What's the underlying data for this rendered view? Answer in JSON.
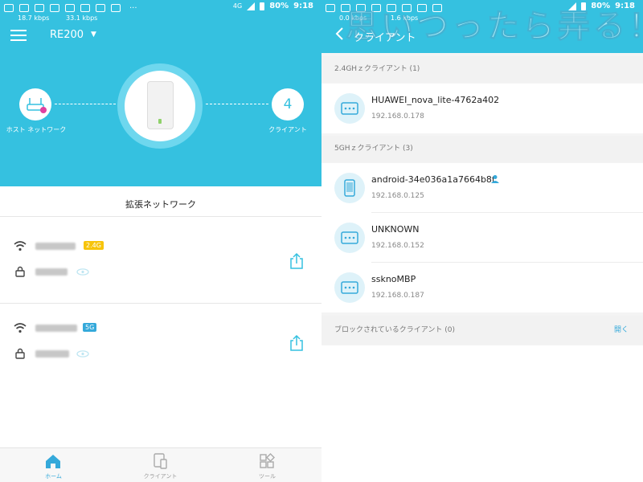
{
  "left": {
    "status_bar": {
      "speed_up": "18.7 kbps",
      "speed_down": "33.1 kbps",
      "network": "4G",
      "battery": "80%",
      "time": "9:18"
    },
    "header": {
      "device_name": "RE200"
    },
    "topology": {
      "host_label": "ホスト ネットワーク",
      "client_count": "4",
      "client_label": "クライアント"
    },
    "section_title": "拡張ネットワーク",
    "networks": [
      {
        "band": "2.4G",
        "band_color": "#f7c40b"
      },
      {
        "band": "5G",
        "band_color": "#35a9da"
      }
    ],
    "tabs": [
      {
        "label": "ホーム",
        "icon": "home-icon"
      },
      {
        "label": "クライアント",
        "icon": "devices-icon"
      },
      {
        "label": "ツール",
        "icon": "tools-icon"
      }
    ]
  },
  "right": {
    "status_bar": {
      "speed_up": "0.0 kbps",
      "speed_down": "1.6 kbps",
      "battery": "80%",
      "time": "9:18"
    },
    "header": {
      "title": "クライアント"
    },
    "watermark": "思いつったら弄る！",
    "groups": {
      "g24_label": "2.4GHｚクライアント (1)",
      "g5_label": "5GHｚクライアント (3)",
      "blocked_label": "ブロックされているクライアント (0)",
      "blocked_action": "開く"
    },
    "clients_24": [
      {
        "name": "HUAWEI_nova_lite-4762a402",
        "ip": "192.168.0.178",
        "icon": "generic-device-icon"
      }
    ],
    "clients_5": [
      {
        "name": "android-34e036a1a7664b8f",
        "ip": "192.168.0.125",
        "icon": "phone-icon"
      },
      {
        "name": "UNKNOWN",
        "ip": "192.168.0.152",
        "icon": "generic-device-icon"
      },
      {
        "name": "ssknoMBP",
        "ip": "192.168.0.187",
        "icon": "generic-device-icon"
      }
    ]
  },
  "colors": {
    "accent": "#35c1e0",
    "link": "#35a9da",
    "band_24": "#f7c40b",
    "band_5": "#35a9da"
  }
}
